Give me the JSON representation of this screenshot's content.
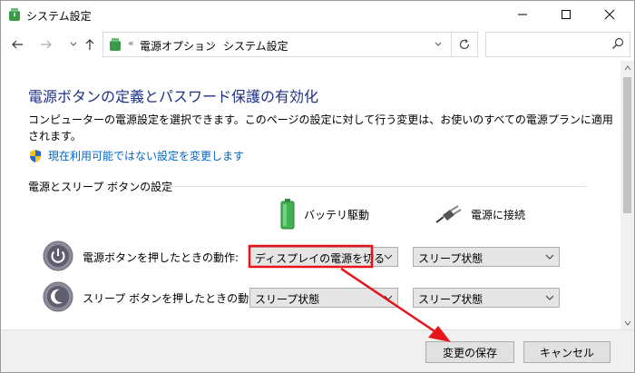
{
  "window": {
    "title": "システム設定"
  },
  "nav": {
    "breadcrumb_sep": "«",
    "crumbs": [
      "電源オプション",
      "システム設定"
    ],
    "crumb_chevron": "›",
    "search_placeholder": ""
  },
  "content": {
    "heading": "電源ボタンの定義とパスワード保護の有効化",
    "description": "コンピューターの電源設定を選択できます。このページの設定に対して行う変更は、お使いのすべての電源プランに適用されます。",
    "change_link": "現在利用可能ではない設定を変更します",
    "group_title": "電源とスリープ ボタンの設定",
    "col_battery": "バッテリ駆動",
    "col_ac": "電源に接続",
    "rows": [
      {
        "label": "電源ボタンを押したときの動作:",
        "battery": "ディスプレイの電源を切る",
        "ac": "スリープ状態"
      },
      {
        "label": "スリープ ボタンを押したときの動作:",
        "battery": "スリープ状態",
        "ac": "スリープ状態"
      }
    ]
  },
  "footer": {
    "save_label": "変更の保存",
    "cancel_label": "キャンセル"
  },
  "icons": {
    "app": "power-options-icon",
    "minimize": "minimize-icon",
    "maximize": "maximize-icon",
    "close": "close-icon",
    "back": "arrow-left-icon",
    "forward": "arrow-right-icon",
    "up": "arrow-up-icon",
    "refresh": "refresh-icon",
    "search": "search-icon",
    "shield": "uac-shield-icon",
    "battery": "battery-icon",
    "plug": "plug-icon",
    "power_button": "power-button-icon",
    "sleep_button": "sleep-button-icon"
  },
  "colors": {
    "heading": "#1e3287",
    "link": "#0066cc",
    "annotation_arrow": "#e8141c",
    "annotation_box": "#e8141c"
  }
}
